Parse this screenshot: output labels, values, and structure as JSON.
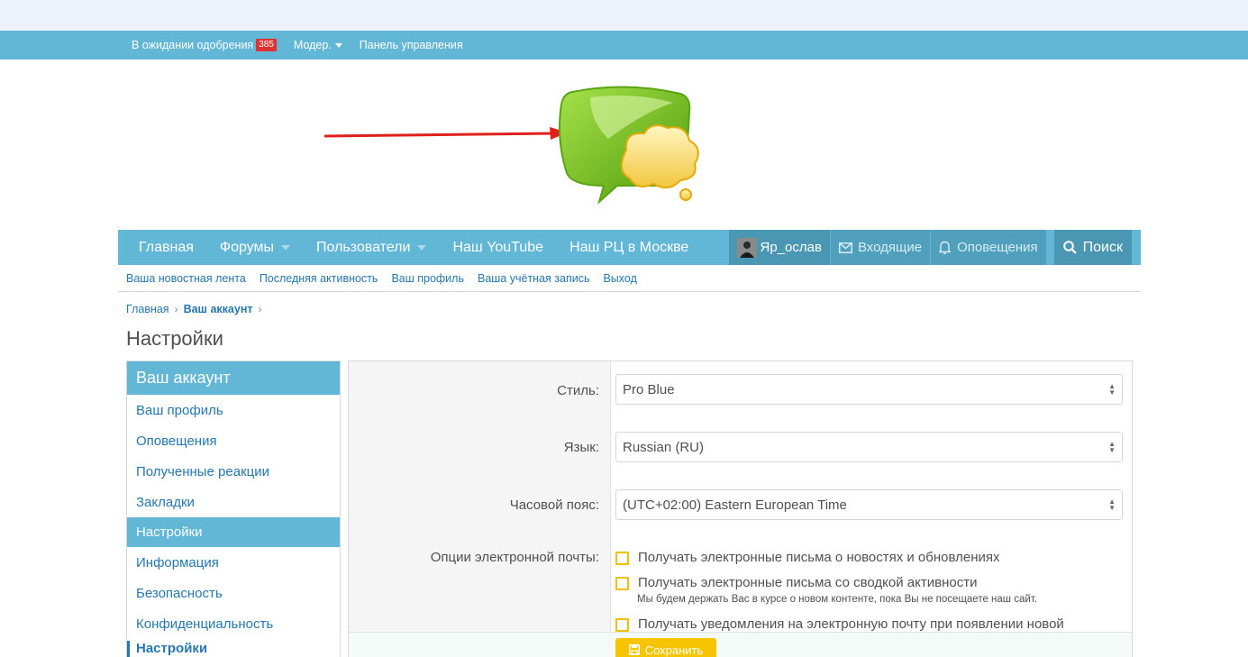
{
  "staff_bar": {
    "pending_label": "В ожидании одобрения",
    "pending_count": "385",
    "moder_label": "Модер.",
    "panel_label": "Панель управления"
  },
  "nav": {
    "tabs": [
      {
        "label": "Главная"
      },
      {
        "label": "Форумы"
      },
      {
        "label": "Пользователи"
      },
      {
        "label": "Наш YouTube"
      },
      {
        "label": "Наш РЦ в Москве"
      }
    ],
    "user_label": "Яр_ослав",
    "inbox_label": "Входящие",
    "alerts_label": "Оповещения",
    "search_label": "Поиск"
  },
  "subnav": {
    "items": [
      {
        "label": "Ваша новостная лента"
      },
      {
        "label": "Последняя активность"
      },
      {
        "label": "Ваш профиль"
      },
      {
        "label": "Ваша учётная запись"
      },
      {
        "label": "Выход"
      }
    ]
  },
  "breadcrumb": {
    "home": "Главная",
    "current": "Ваш аккаунт"
  },
  "page_title": "Настройки",
  "sidebar": {
    "heading": "Ваш аккаунт",
    "items": [
      {
        "label": "Ваш профиль"
      },
      {
        "label": "Оповещения"
      },
      {
        "label": "Полученные реакции"
      },
      {
        "label": "Закладки"
      },
      {
        "label": "Настройки"
      },
      {
        "label": "Информация"
      },
      {
        "label": "Безопасность"
      },
      {
        "label": "Конфиденциальность"
      }
    ],
    "sub_active": "Настройки"
  },
  "form": {
    "style_label": "Стиль:",
    "style_value": "Pro Blue",
    "language_label": "Язык:",
    "language_value": "Russian (RU)",
    "timezone_label": "Часовой пояс:",
    "timezone_value": "(UTC+02:00) Eastern European Time",
    "email_label": "Опции электронной почты:",
    "email_options": [
      {
        "label": "Получать электронные письма о новостях и обновлениях"
      },
      {
        "label": "Получать электронные письма со сводкой активности"
      },
      {
        "label": "Получать уведомления на электронную почту при появлении новой"
      }
    ],
    "digest_hint": "Мы будем держать Вас в курсе о новом контенте, пока Вы не посещаете наш сайт.",
    "save_label": "Сохранить"
  },
  "colors": {
    "accent": "#62b6d6",
    "link": "#2577b1",
    "save": "#f6c500",
    "badge": "#e03030"
  }
}
